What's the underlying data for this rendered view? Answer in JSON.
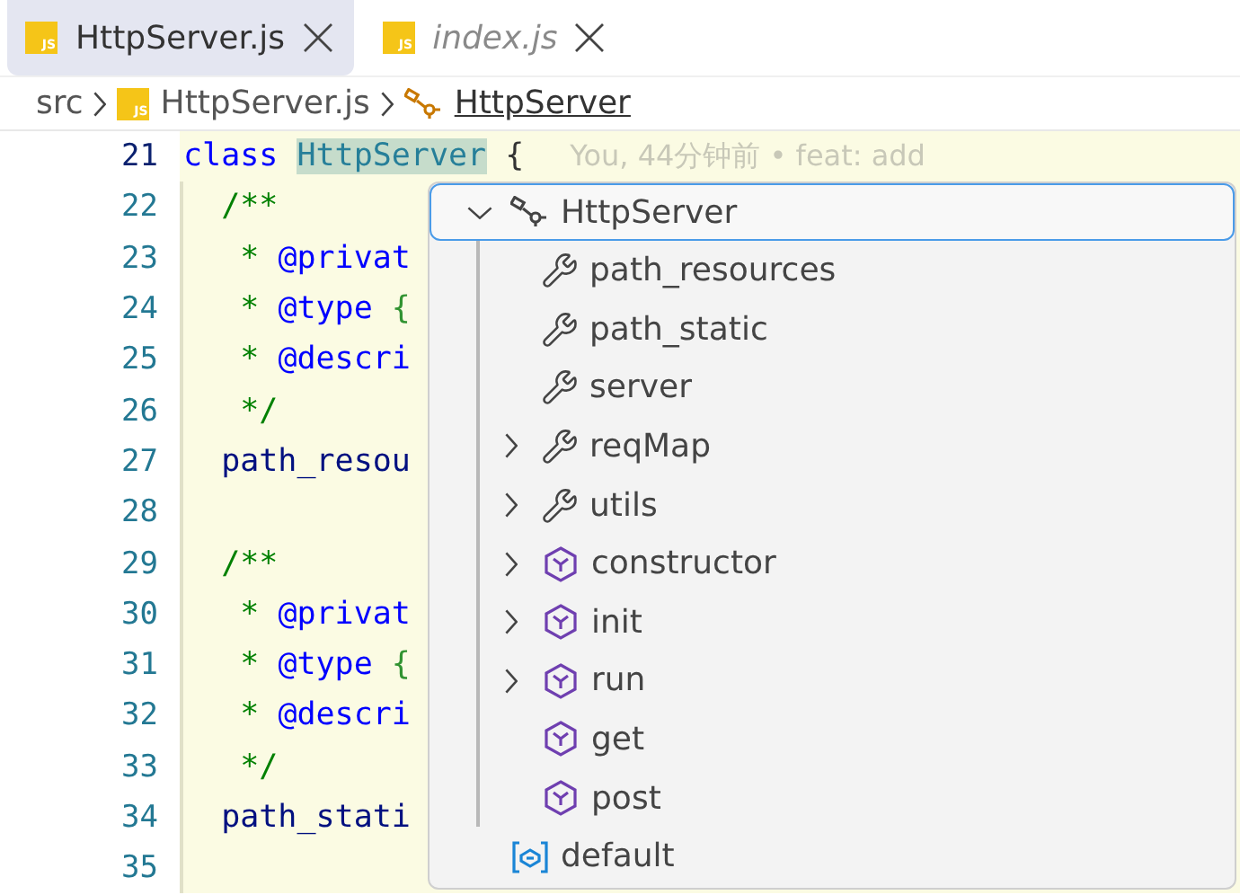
{
  "tabs": [
    {
      "label": "HttpServer.js",
      "file_icon": "JS",
      "selected": true,
      "preview": false
    },
    {
      "label": "index.js",
      "file_icon": "JS",
      "selected": false,
      "preview": true
    }
  ],
  "breadcrumb": [
    {
      "label": "src",
      "kind": "folder"
    },
    {
      "label": "HttpServer.js",
      "kind": "file",
      "file_icon": "JS"
    },
    {
      "label": "HttpServer",
      "kind": "class"
    }
  ],
  "code_lines": [
    {
      "number": "21",
      "current": true,
      "tokens": [
        {
          "kind": "keyword",
          "text": "class "
        },
        {
          "kind": "classname",
          "text": "HttpServer"
        },
        {
          "kind": "punct",
          "text": " {"
        },
        {
          "kind": "blame",
          "text": "     You, 44分钟前 • feat: add"
        }
      ]
    },
    {
      "number": "22",
      "current": false,
      "tokens": [
        {
          "kind": "comment",
          "text": "  /**"
        }
      ]
    },
    {
      "number": "23",
      "current": false,
      "tokens": [
        {
          "kind": "comment",
          "text": "   * "
        },
        {
          "kind": "tag",
          "text": "@privat"
        }
      ]
    },
    {
      "number": "24",
      "current": false,
      "tokens": [
        {
          "kind": "comment",
          "text": "   * "
        },
        {
          "kind": "tag",
          "text": "@type "
        },
        {
          "kind": "brace",
          "text": "{"
        }
      ]
    },
    {
      "number": "25",
      "current": false,
      "tokens": [
        {
          "kind": "comment",
          "text": "   * "
        },
        {
          "kind": "tag",
          "text": "@descri"
        }
      ]
    },
    {
      "number": "26",
      "current": false,
      "tokens": [
        {
          "kind": "comment",
          "text": "   */"
        }
      ]
    },
    {
      "number": "27",
      "current": false,
      "tokens": [
        {
          "kind": "ident",
          "text": "  path_resou"
        }
      ]
    },
    {
      "number": "28",
      "current": false
    },
    {
      "number": "29",
      "current": false,
      "tokens": [
        {
          "kind": "comment",
          "text": "  /**"
        }
      ]
    },
    {
      "number": "30",
      "current": false,
      "tokens": [
        {
          "kind": "comment",
          "text": "   * "
        },
        {
          "kind": "tag",
          "text": "@privat"
        }
      ]
    },
    {
      "number": "31",
      "current": false,
      "tokens": [
        {
          "kind": "comment",
          "text": "   * "
        },
        {
          "kind": "tag",
          "text": "@type "
        },
        {
          "kind": "brace",
          "text": "{"
        }
      ]
    },
    {
      "number": "32",
      "current": false,
      "tokens": [
        {
          "kind": "comment",
          "text": "   * "
        },
        {
          "kind": "tag",
          "text": "@descri"
        }
      ]
    },
    {
      "number": "33",
      "current": false,
      "tokens": [
        {
          "kind": "comment",
          "text": "   */"
        }
      ]
    },
    {
      "number": "34",
      "current": false,
      "tokens": [
        {
          "kind": "ident",
          "text": "  path_stati"
        }
      ]
    },
    {
      "number": "35",
      "current": false
    }
  ],
  "outline": [
    {
      "label": "HttpServer",
      "kind": "class",
      "expanded": true,
      "focused": true,
      "children": [
        {
          "label": "path_resources",
          "kind": "field",
          "expandable": false
        },
        {
          "label": "path_static",
          "kind": "field",
          "expandable": false
        },
        {
          "label": "server",
          "kind": "field",
          "expandable": false
        },
        {
          "label": "reqMap",
          "kind": "field",
          "expandable": true
        },
        {
          "label": "utils",
          "kind": "field",
          "expandable": true
        },
        {
          "label": "constructor",
          "kind": "method",
          "expandable": true
        },
        {
          "label": "init",
          "kind": "method",
          "expandable": true
        },
        {
          "label": "run",
          "kind": "method",
          "expandable": true
        },
        {
          "label": "get",
          "kind": "method",
          "expandable": false
        },
        {
          "label": "post",
          "kind": "method",
          "expandable": false
        }
      ]
    },
    {
      "label": "default",
      "kind": "variable",
      "focused": false
    }
  ]
}
